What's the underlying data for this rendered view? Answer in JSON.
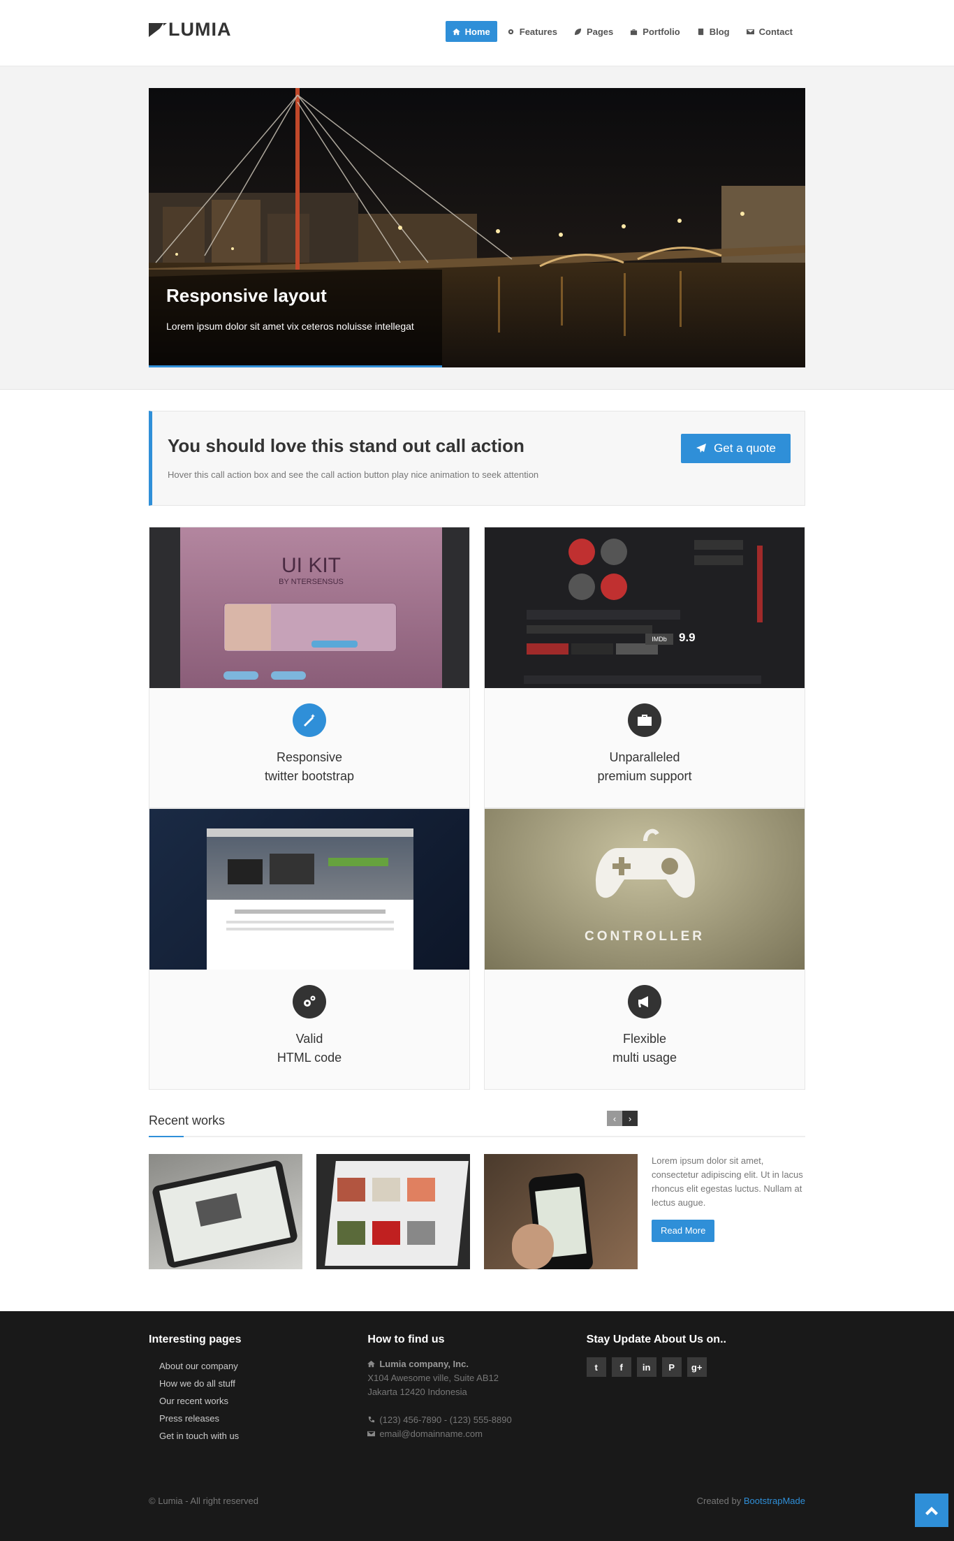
{
  "header": {
    "logo": "LUMIA",
    "nav": [
      {
        "label": "Home",
        "icon": "home-icon",
        "active": true
      },
      {
        "label": "Features",
        "icon": "gear-icon"
      },
      {
        "label": "Pages",
        "icon": "leaf-icon"
      },
      {
        "label": "Portfolio",
        "icon": "briefcase-icon"
      },
      {
        "label": "Blog",
        "icon": "book-icon"
      },
      {
        "label": "Contact",
        "icon": "envelope-icon"
      }
    ]
  },
  "slider": {
    "title": "Responsive layout",
    "text": "Lorem ipsum dolor sit amet vix ceteros noluisse intellegat"
  },
  "cta": {
    "title": "You should love this stand out call action",
    "text": "Hover this call action box and see the call action button play nice animation to seek attention",
    "button": "Get a quote"
  },
  "features": [
    {
      "line1": "Responsive",
      "line2": "twitter bootstrap",
      "icon": "magic-wand-icon",
      "color": "#2f8fd8",
      "thumb_title": "UI KIT",
      "thumb_sub": "BY NTERSENSUS"
    },
    {
      "line1": "Unparalleled",
      "line2": "premium support",
      "icon": "briefcase-icon",
      "color": "#333333",
      "thumb_value": "9.9"
    },
    {
      "line1": "Valid",
      "line2": "HTML code",
      "icon": "cogs-icon",
      "color": "#333333"
    },
    {
      "line1": "Flexible",
      "line2": "multi usage",
      "icon": "bullhorn-icon",
      "color": "#333333",
      "thumb_title": "CONTROLLER"
    }
  ],
  "recent": {
    "title": "Recent works",
    "text": "Lorem ipsum dolor sit amet, consectetur adipiscing elit. Ut in lacus rhoncus elit egestas luctus. Nullam at lectus augue.",
    "button": "Read More"
  },
  "footer": {
    "col1_title": "Interesting pages",
    "links": [
      "About our company",
      "How we do all stuff",
      "Our recent works",
      "Press releases",
      "Get in touch with us"
    ],
    "col2_title": "How to find us",
    "company": "Lumia company, Inc.",
    "addr1": "X104 Awesome ville, Suite AB12",
    "addr2": "Jakarta 12420 Indonesia",
    "phone": "(123) 456-7890 - (123) 555-8890",
    "email": "email@domainname.com",
    "col3_title": "Stay Update About Us on..",
    "social": [
      "twitter-icon",
      "facebook-icon",
      "linkedin-icon",
      "pinterest-icon",
      "google-plus-icon"
    ],
    "copyright": "© Lumia - All right reserved",
    "created_prefix": "Created by",
    "created_link": "BootstrapMade"
  },
  "colors": {
    "accent": "#2f8fd8",
    "footer_bg": "#191919",
    "hero_band": "#f3f3f3"
  }
}
